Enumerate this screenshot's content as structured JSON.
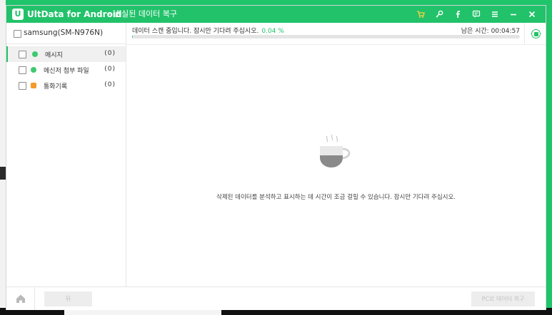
{
  "titlebar": {
    "app_name": "UltData for Android",
    "separator": "-",
    "subtitle": "손실된 데이터 복구",
    "logo_letter": "U",
    "icons": [
      "cart-icon",
      "key-icon",
      "facebook-icon",
      "feedback-icon",
      "menu-icon",
      "minimize-icon",
      "close-icon"
    ]
  },
  "sidebar": {
    "device": "samsung(SM-N976N)",
    "categories": [
      {
        "label": "메시지",
        "count": "(0)",
        "icon": "message-icon",
        "active": true
      },
      {
        "label": "메신저 첨부 파일",
        "count": "(0)",
        "icon": "message-attachment-icon",
        "active": false
      },
      {
        "label": "통화기록",
        "count": "(0)",
        "icon": "call-log-icon",
        "active": false
      }
    ]
  },
  "main": {
    "scan_status": "데이터 스캔 중입니다. 잠시만 기다려 주십시오.",
    "scan_percent": "0.04 %",
    "scan_progress": 0.0004,
    "time_left": "남은 시간: 00:04:57",
    "wait_message": "삭제된 데이터를 분석하고 표시하는 데 시간이 조금 걸릴 수 있습니다. 잠시만 기다려 주십시오."
  },
  "footer": {
    "back_label": "뒤",
    "recover_label": "PC로 데이터 복구"
  },
  "colors": {
    "accent": "#22c26a",
    "cart": "#ffd23c",
    "call_icon": "#f39a2a"
  }
}
